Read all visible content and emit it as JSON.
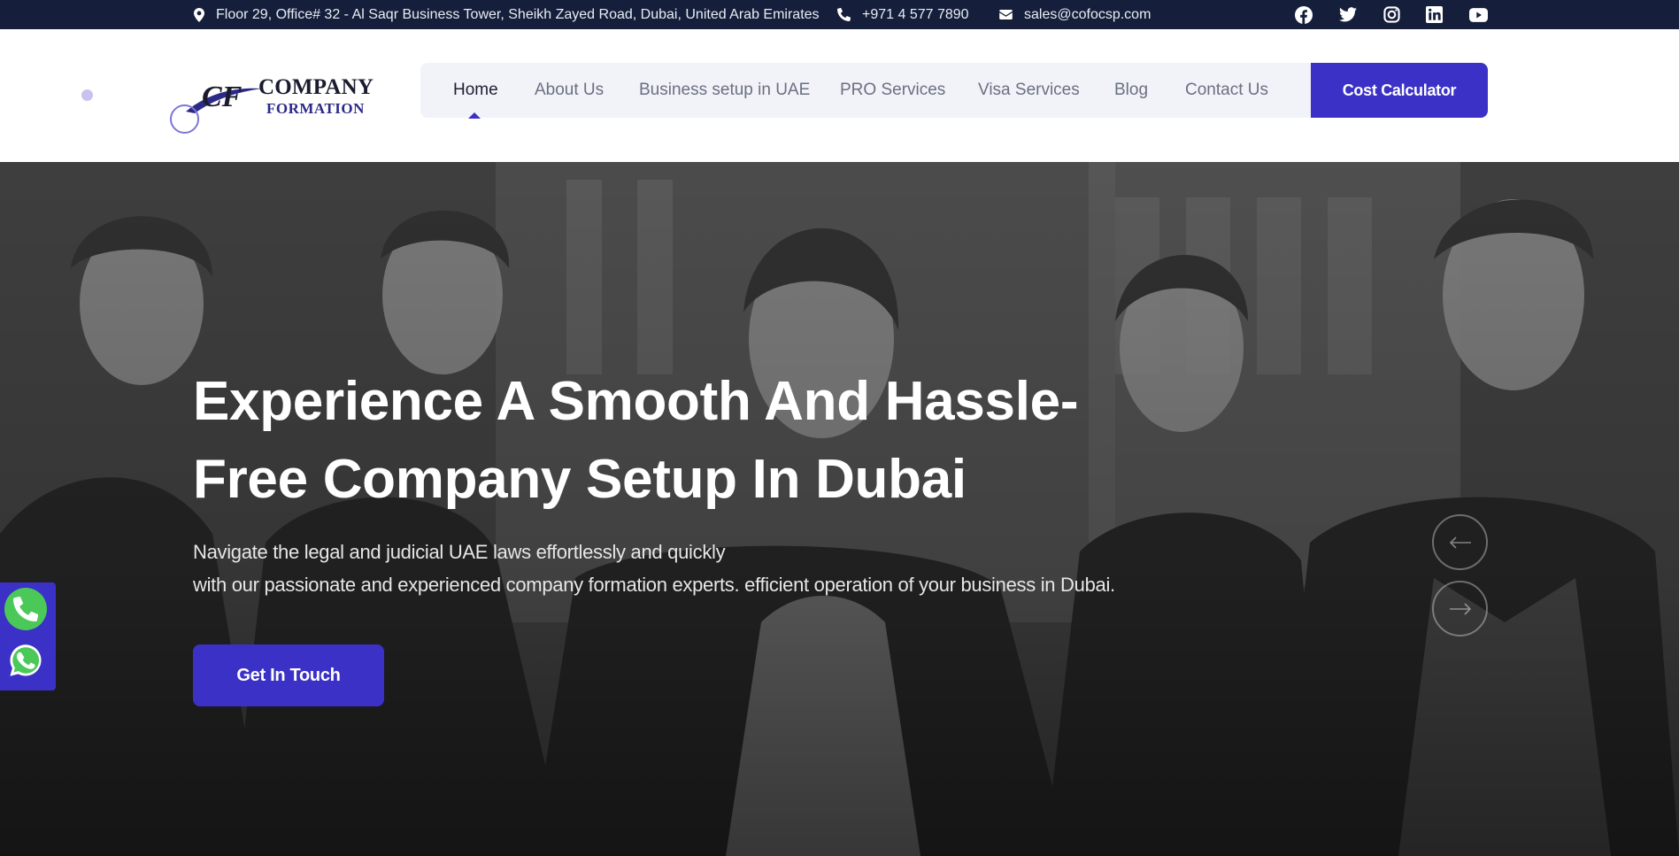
{
  "topbar": {
    "address": "Floor 29, Office# 32 - Al Saqr Business Tower, Sheikh Zayed Road, Dubai, United Arab Emirates",
    "phone": "+971 4 577 7890",
    "email": "sales@cofocsp.com",
    "icons": {
      "address": "map-pin-icon",
      "phone": "phone-icon",
      "email": "envelope-icon"
    },
    "social": [
      "facebook-icon",
      "twitter-icon",
      "instagram-icon",
      "linkedin-icon",
      "youtube-icon"
    ],
    "background_color": "#151f3b"
  },
  "logo": {
    "mark": "CF",
    "line1": "COMPANY",
    "line2": "FORMATION"
  },
  "nav": {
    "items": [
      {
        "label": "Home",
        "active": true
      },
      {
        "label": "About Us",
        "active": false
      },
      {
        "label": "Business setup in UAE",
        "active": false
      },
      {
        "label": "PRO Services",
        "active": false
      },
      {
        "label": "Visa Services",
        "active": false
      },
      {
        "label": "Blog",
        "active": false
      },
      {
        "label": "Contact Us",
        "active": false
      }
    ],
    "cta_label": "Cost Calculator"
  },
  "hero": {
    "title": "Experience A Smooth And Hassle-Free Company Setup In Dubai",
    "subtitle_line1": "Navigate the legal and judicial UAE laws effortlessly and quickly",
    "subtitle_line2": "with our passionate and experienced company formation experts. efficient operation of your business in Dubai.",
    "button_label": "Get In Touch",
    "slider_controls": [
      "arrow-left-icon",
      "arrow-right-icon"
    ]
  },
  "floating_contact": {
    "buttons": [
      "phone-icon",
      "whatsapp-icon"
    ]
  },
  "colors": {
    "accent": "#3b31c6",
    "topbar": "#151f3b",
    "nav_bg": "#f1f3f9",
    "whatsapp_green": "#4ac959"
  }
}
